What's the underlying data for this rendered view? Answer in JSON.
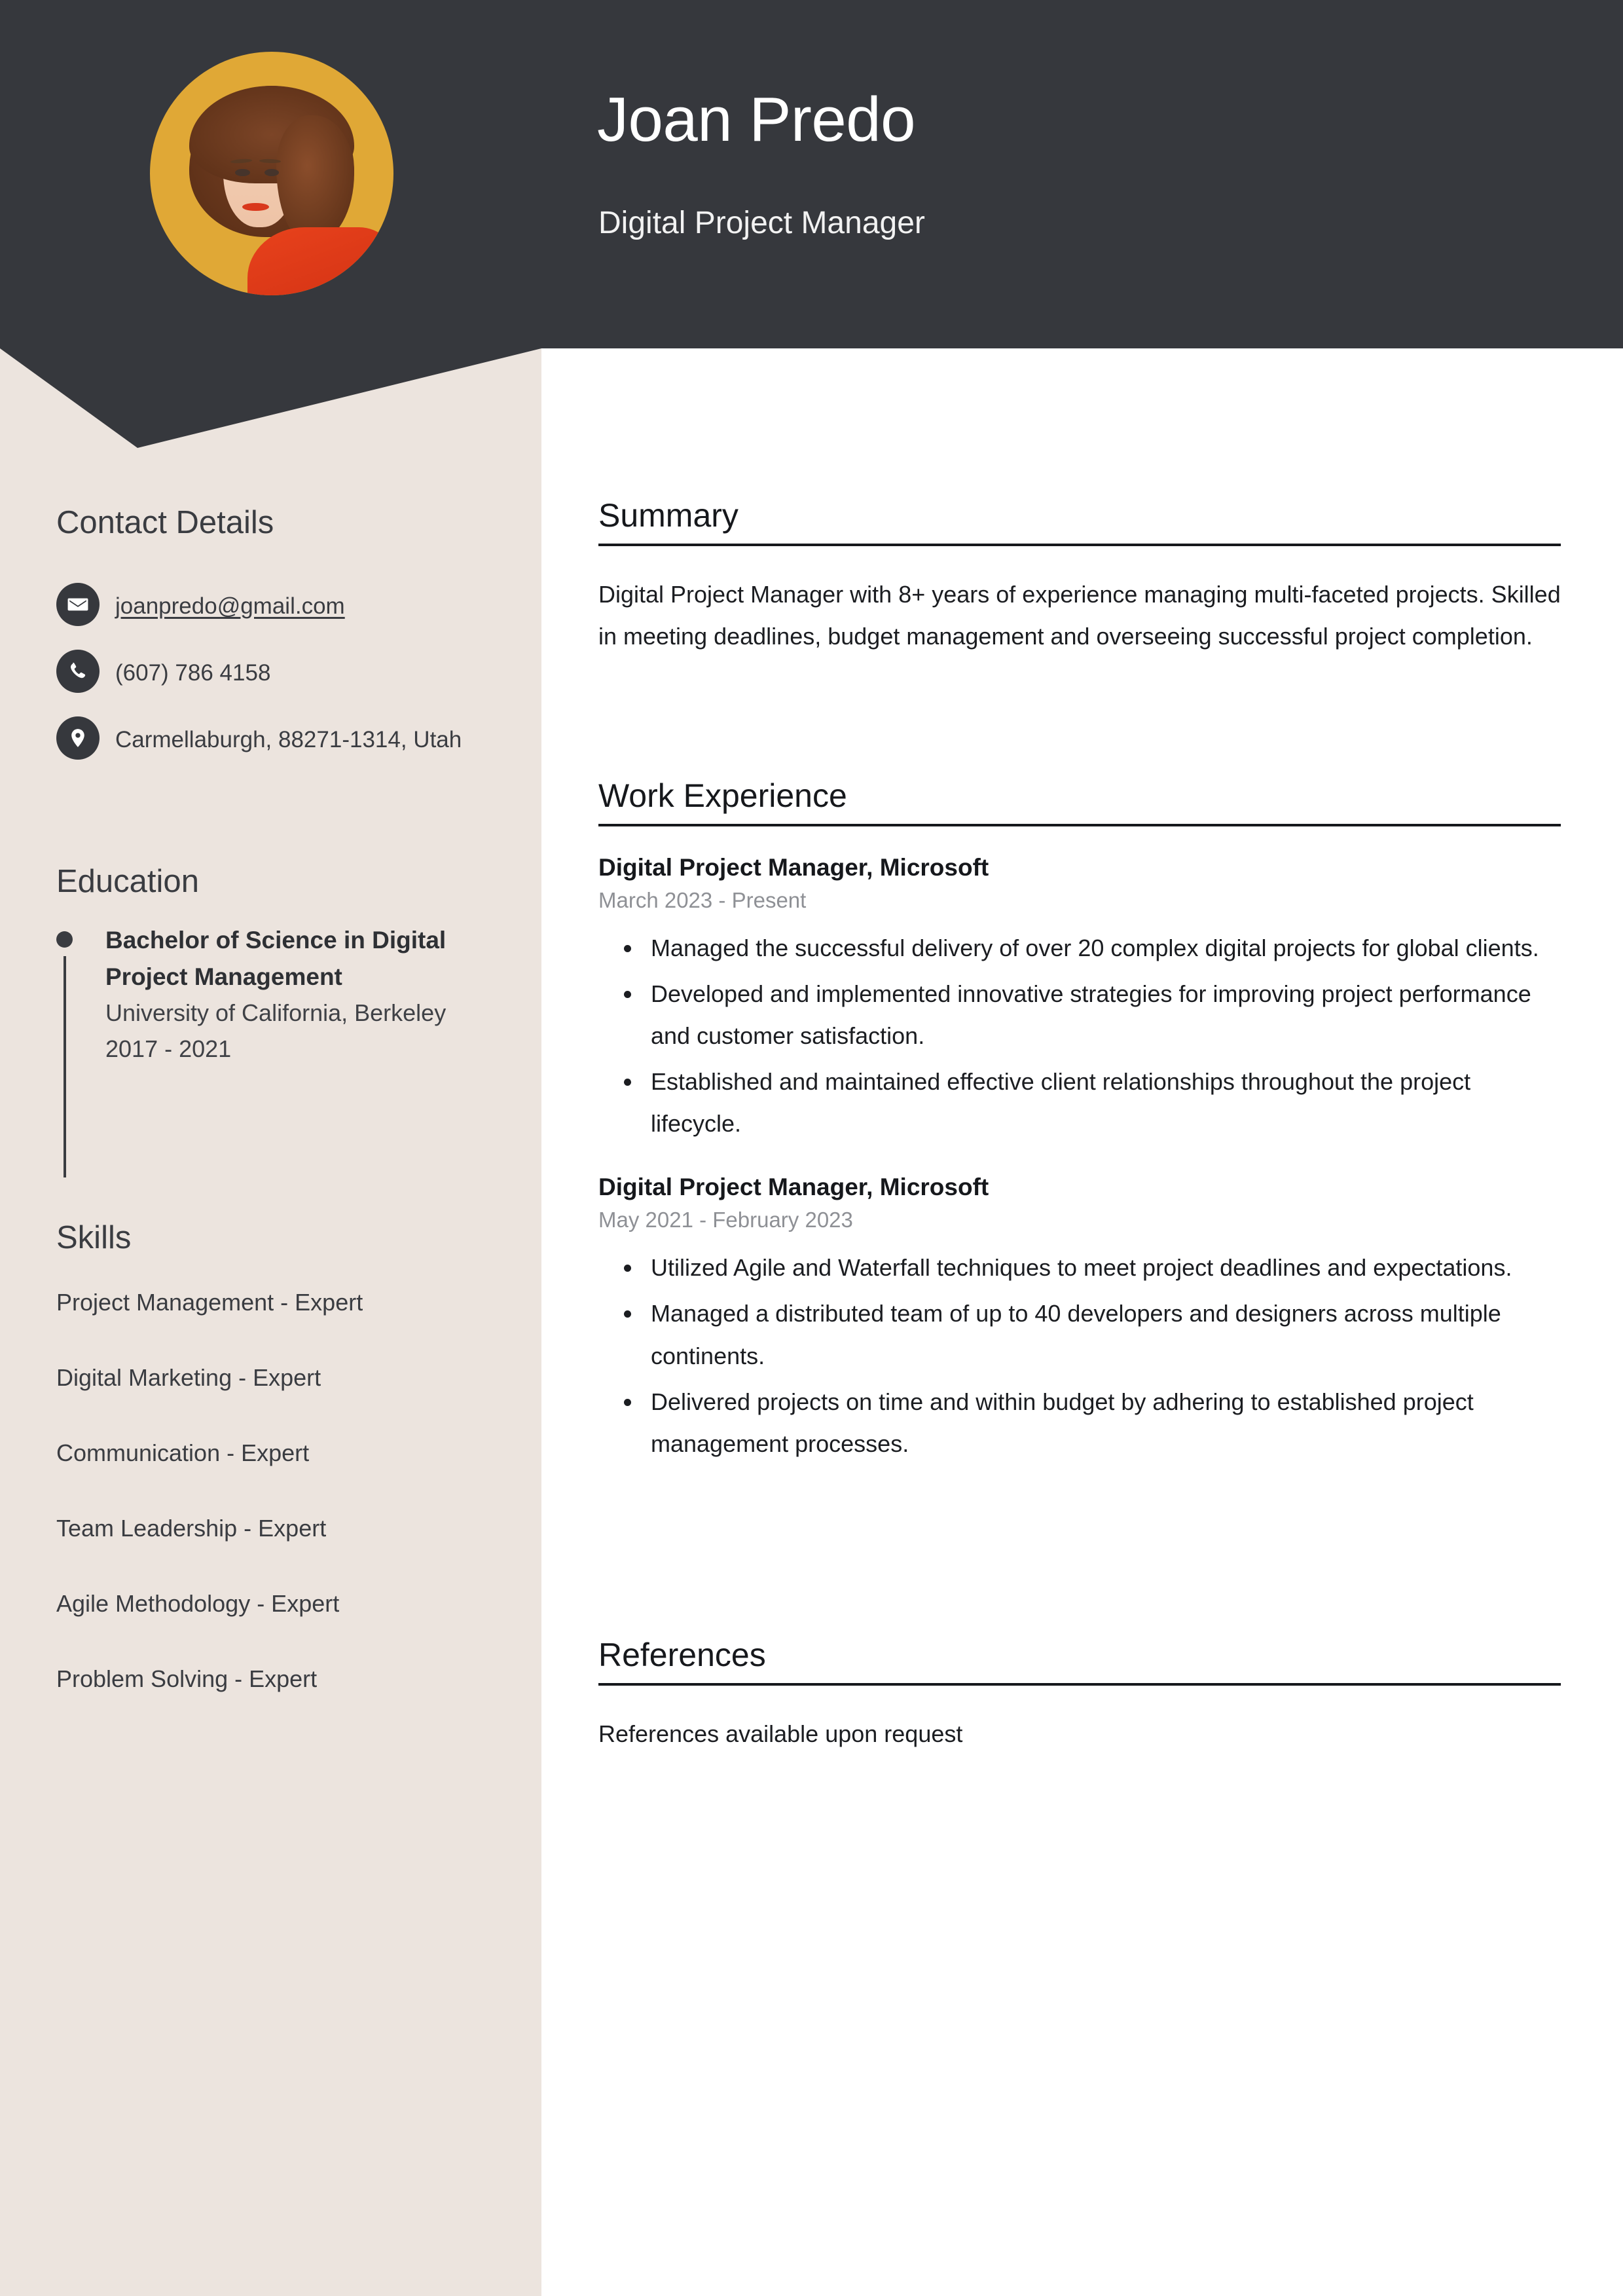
{
  "theme": {
    "header_bg": "#36383d",
    "sidebar_bg": "#ece4de",
    "main_bg": "#ffffff",
    "text_dark": "#3a3c41",
    "muted_text": "#8e9095",
    "avatar_bg": "#e0a836"
  },
  "header": {
    "name": "Joan Predo",
    "job_title": "Digital Project Manager",
    "avatar_alt": "portrait-photo"
  },
  "sidebar": {
    "contact": {
      "heading": "Contact Details",
      "items": [
        {
          "icon": "envelope-icon",
          "value": "joanpredo@gmail.com",
          "is_link": true
        },
        {
          "icon": "phone-icon",
          "value": "(607) 786 4158",
          "is_link": false
        },
        {
          "icon": "location-pin-icon",
          "value": "Carmellaburgh, 88271-1314, Utah",
          "is_link": false
        }
      ]
    },
    "education": {
      "heading": "Education",
      "items": [
        {
          "degree": "Bachelor of Science in Digital Project Management",
          "school": "University of California, Berkeley",
          "dates": "2017 - 2021"
        }
      ]
    },
    "skills": {
      "heading": "Skills",
      "items": [
        "Project Management - Expert",
        "Digital Marketing - Expert",
        "Communication - Expert",
        "Team Leadership - Expert",
        "Agile Methodology - Expert",
        "Problem Solving - Expert"
      ]
    }
  },
  "main": {
    "summary": {
      "heading": "Summary",
      "body": "Digital Project Manager with 8+ years of experience managing multi-faceted projects. Skilled in meeting deadlines, budget management and overseeing successful project completion."
    },
    "work_experience": {
      "heading": "Work Experience",
      "jobs": [
        {
          "title": "Digital Project Manager, Microsoft",
          "dates": "March 2023 - Present",
          "bullets": [
            "Managed the successful delivery of over 20 complex digital projects for global clients.",
            "Developed and implemented innovative strategies for improving project performance and customer satisfaction.",
            "Established and maintained effective client relationships throughout the project lifecycle."
          ]
        },
        {
          "title": "Digital Project Manager, Microsoft",
          "dates": "May 2021 - February 2023",
          "bullets": [
            "Utilized Agile and Waterfall techniques to meet project deadlines and expectations.",
            "Managed a distributed team of up to 40 developers and designers across multiple continents.",
            "Delivered projects on time and within budget by adhering to established project management processes."
          ]
        }
      ]
    },
    "references": {
      "heading": "References",
      "body": "References available upon request"
    }
  }
}
